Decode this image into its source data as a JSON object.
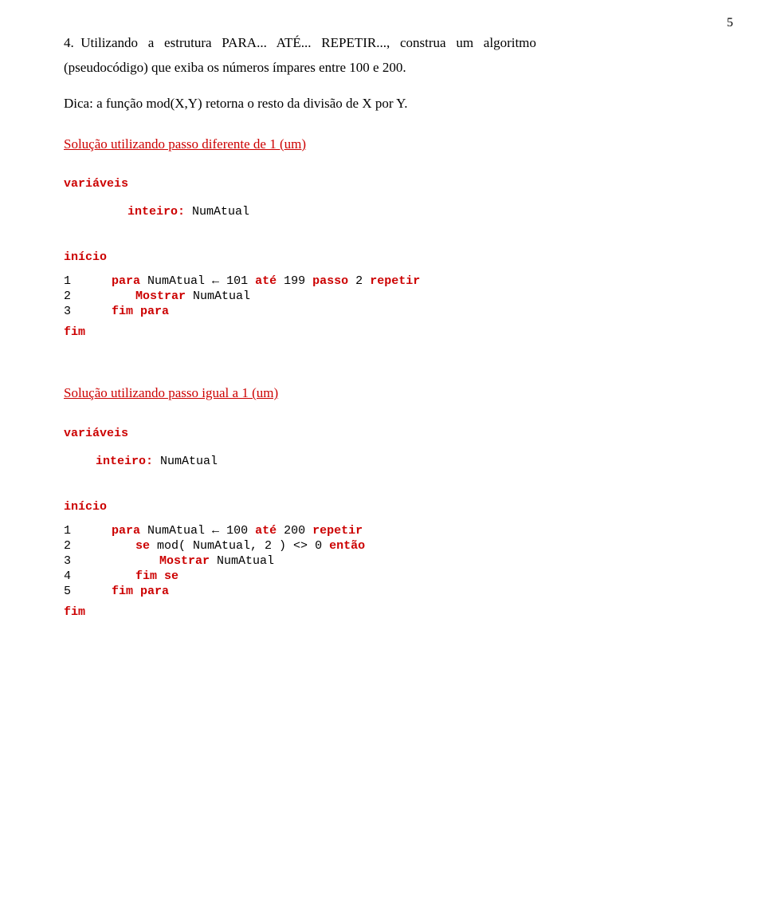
{
  "page": {
    "number": "5",
    "question": {
      "number": "4",
      "text_part1": "4. Utilizando  a  estrutura  PARA...  ATÉ...  REPETIR..., construa  um  algoritmo",
      "text_part2": "(pseudocódigo) que exiba os números ímpares entre 100 e 200.",
      "hint": "Dica: a função mod(X,Y) retorna o resto da divisão de X por Y."
    },
    "solution1": {
      "title": "Solução utilizando passo diferente de 1 (um)",
      "variables_label": "variáveis",
      "inteiro_label": "inteiro:",
      "var_name": "NumAtual",
      "inicio_label": "início",
      "fim_label": "fim",
      "lines": [
        {
          "number": "1",
          "content_parts": [
            {
              "text": "para",
              "style": "keyword"
            },
            {
              "text": " NumAtual ",
              "style": "normal"
            },
            {
              "text": "←",
              "style": "normal"
            },
            {
              "text": " 101 ",
              "style": "normal"
            },
            {
              "text": "até",
              "style": "keyword"
            },
            {
              "text": " 199 ",
              "style": "normal"
            },
            {
              "text": "passo",
              "style": "keyword"
            },
            {
              "text": " 2 ",
              "style": "normal"
            },
            {
              "text": "repetir",
              "style": "keyword"
            }
          ]
        },
        {
          "number": "2",
          "content_parts": [
            {
              "text": "Mostrar",
              "style": "keyword"
            },
            {
              "text": " NumAtual",
              "style": "normal"
            }
          ]
        },
        {
          "number": "3",
          "content_parts": [
            {
              "text": "fim",
              "style": "keyword"
            },
            {
              "text": " ",
              "style": "normal"
            },
            {
              "text": "para",
              "style": "keyword"
            }
          ]
        }
      ]
    },
    "solution2": {
      "title": "Solução utilizando passo igual a 1 (um)",
      "variables_label": "variáveis",
      "inteiro_label": "inteiro:",
      "var_name": "NumAtual",
      "inicio_label": "início",
      "fim_label": "fim",
      "lines": [
        {
          "number": "1",
          "content_parts": [
            {
              "text": "para",
              "style": "keyword"
            },
            {
              "text": " NumAtual ",
              "style": "normal"
            },
            {
              "text": "←",
              "style": "normal"
            },
            {
              "text": " 100 ",
              "style": "normal"
            },
            {
              "text": "até",
              "style": "keyword"
            },
            {
              "text": " 200 ",
              "style": "normal"
            },
            {
              "text": "repetir",
              "style": "keyword"
            }
          ]
        },
        {
          "number": "2",
          "content_parts": [
            {
              "text": "se",
              "style": "keyword"
            },
            {
              "text": " mod( NumAtual, 2 ) <> 0 ",
              "style": "normal"
            },
            {
              "text": "então",
              "style": "keyword"
            }
          ]
        },
        {
          "number": "3",
          "content_parts": [
            {
              "text": "Mostrar",
              "style": "keyword"
            },
            {
              "text": " NumAtual",
              "style": "normal"
            }
          ]
        },
        {
          "number": "4",
          "content_parts": [
            {
              "text": "fim",
              "style": "keyword"
            },
            {
              "text": " ",
              "style": "normal"
            },
            {
              "text": "se",
              "style": "keyword"
            }
          ]
        },
        {
          "number": "5",
          "content_parts": [
            {
              "text": "fim",
              "style": "keyword"
            },
            {
              "text": " ",
              "style": "normal"
            },
            {
              "text": "para",
              "style": "keyword"
            }
          ]
        }
      ]
    }
  }
}
